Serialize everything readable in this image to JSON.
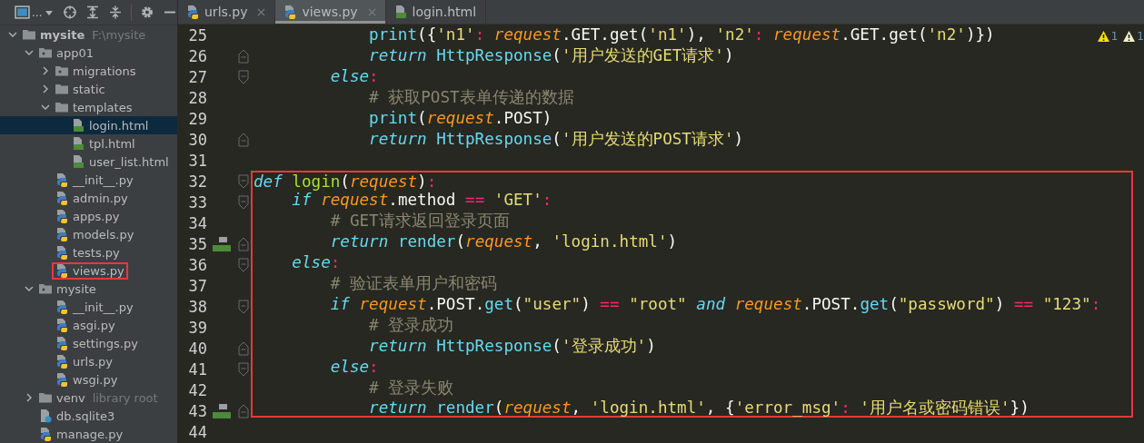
{
  "toolbar": {
    "view_selector": {
      "label": "..."
    },
    "buttons": [
      {
        "kind": "locate"
      },
      {
        "kind": "expand"
      },
      {
        "kind": "collapse"
      },
      {
        "kind": "settings"
      },
      {
        "kind": "hide"
      }
    ]
  },
  "project_tree": [
    {
      "label": "mysite",
      "hint": "F:\\mysite",
      "kind": "folder",
      "bold": true,
      "expanded": true,
      "selected": false,
      "boxed": false,
      "children": [
        {
          "label": "app01",
          "kind": "package",
          "expanded": true,
          "selected": false,
          "boxed": false,
          "children": [
            {
              "label": "migrations",
              "kind": "package",
              "expanded": false,
              "selected": false,
              "boxed": false
            },
            {
              "label": "static",
              "kind": "folder",
              "expanded": false,
              "selected": false,
              "boxed": false
            },
            {
              "label": "templates",
              "kind": "folder",
              "expanded": true,
              "selected": false,
              "boxed": false,
              "children": [
                {
                  "label": "login.html",
                  "kind": "html",
                  "selected": true,
                  "boxed": false
                },
                {
                  "label": "tpl.html",
                  "kind": "html",
                  "selected": false,
                  "boxed": false
                },
                {
                  "label": "user_list.html",
                  "kind": "html",
                  "selected": false,
                  "boxed": false
                }
              ]
            },
            {
              "label": "__init__.py",
              "kind": "python",
              "selected": false,
              "boxed": false
            },
            {
              "label": "admin.py",
              "kind": "python",
              "selected": false,
              "boxed": false
            },
            {
              "label": "apps.py",
              "kind": "python",
              "selected": false,
              "boxed": false
            },
            {
              "label": "models.py",
              "kind": "python",
              "selected": false,
              "boxed": false
            },
            {
              "label": "tests.py",
              "kind": "python",
              "selected": false,
              "boxed": false
            },
            {
              "label": "views.py",
              "kind": "python",
              "selected": false,
              "boxed": true
            }
          ]
        },
        {
          "label": "mysite",
          "kind": "package",
          "expanded": true,
          "selected": false,
          "boxed": false,
          "children": [
            {
              "label": "__init__.py",
              "kind": "python",
              "selected": false,
              "boxed": false
            },
            {
              "label": "asgi.py",
              "kind": "python",
              "selected": false,
              "boxed": false
            },
            {
              "label": "settings.py",
              "kind": "python",
              "selected": false,
              "boxed": false
            },
            {
              "label": "urls.py",
              "kind": "python",
              "selected": false,
              "boxed": false
            },
            {
              "label": "wsgi.py",
              "kind": "python",
              "selected": false,
              "boxed": false
            }
          ]
        },
        {
          "label": "venv",
          "hint": "library root",
          "kind": "folder",
          "expanded": false,
          "selected": false,
          "boxed": false
        },
        {
          "label": "db.sqlite3",
          "kind": "unknown",
          "selected": false,
          "boxed": false
        },
        {
          "label": "manage.py",
          "kind": "python",
          "selected": false,
          "boxed": false
        }
      ]
    }
  ],
  "tabs": [
    {
      "label": "urls.py",
      "kind": "python",
      "selected": false,
      "closable": true
    },
    {
      "label": "views.py",
      "kind": "python",
      "selected": true,
      "closable": true
    },
    {
      "label": "login.html",
      "kind": "html",
      "selected": false,
      "closable": false
    }
  ],
  "warnings": [
    {
      "kind": "warning",
      "count": "1"
    },
    {
      "kind": "weak",
      "count": "1"
    }
  ],
  "editor": {
    "lines": [
      {
        "children": [
          {
            "children": [
              {
                "children": [
                  {
                    "number": "25",
                    "boxed": false,
                    "fold_start": false,
                    "fold_end": false,
                    "html_marker": false,
                    "tokens": [
                      {
                        "kind": "bi",
                        "text": "print"
                      },
                      {
                        "kind": "pl",
                        "text": "({"
                      },
                      {
                        "kind": "str",
                        "text": "'n1'"
                      },
                      {
                        "kind": "op",
                        "text": ":"
                      },
                      {
                        "kind": "param",
                        "text": " request"
                      },
                      {
                        "kind": "pl",
                        "text": ".GET.get("
                      },
                      {
                        "kind": "str",
                        "text": "'n1'"
                      },
                      {
                        "kind": "pl",
                        "text": "), "
                      },
                      {
                        "kind": "str",
                        "text": "'n2'"
                      },
                      {
                        "kind": "op",
                        "text": ":"
                      },
                      {
                        "kind": "param",
                        "text": " request"
                      },
                      {
                        "kind": "pl",
                        "text": ".GET.get("
                      },
                      {
                        "kind": "str",
                        "text": "'n2'"
                      },
                      {
                        "kind": "pl",
                        "text": ")})"
                      }
                    ]
                  },
                  {
                    "number": "26",
                    "boxed": false,
                    "fold_start": false,
                    "fold_end": true,
                    "html_marker": false,
                    "tokens": [
                      {
                        "kind": "kw",
                        "text": "return"
                      },
                      {
                        "kind": "bi",
                        "text": " HttpResponse"
                      },
                      {
                        "kind": "pl",
                        "text": "("
                      },
                      {
                        "kind": "str",
                        "text": "'用户发送的GET请求'"
                      },
                      {
                        "kind": "pl",
                        "text": ")"
                      }
                    ]
                  }
                ]
              },
              {
                "number": "27",
                "boxed": false,
                "fold_start": true,
                "fold_end": false,
                "html_marker": false,
                "tokens": [
                  {
                    "kind": "kw",
                    "text": "else"
                  },
                  {
                    "kind": "op",
                    "text": ":"
                  }
                ],
                "children": [
                  {
                    "number": "28",
                    "boxed": false,
                    "fold_start": false,
                    "fold_end": false,
                    "html_marker": false,
                    "tokens": [
                      {
                        "kind": "cmt",
                        "text": "# 获取POST表单传递的数据"
                      }
                    ]
                  },
                  {
                    "number": "29",
                    "boxed": false,
                    "fold_start": false,
                    "fold_end": false,
                    "html_marker": false,
                    "tokens": [
                      {
                        "kind": "bi",
                        "text": "print"
                      },
                      {
                        "kind": "pl",
                        "text": "("
                      },
                      {
                        "kind": "param",
                        "text": "request"
                      },
                      {
                        "kind": "pl",
                        "text": ".POST)"
                      }
                    ]
                  },
                  {
                    "number": "30",
                    "boxed": false,
                    "fold_start": false,
                    "fold_end": true,
                    "html_marker": false,
                    "tokens": [
                      {
                        "kind": "kw",
                        "text": "return"
                      },
                      {
                        "kind": "bi",
                        "text": " HttpResponse"
                      },
                      {
                        "kind": "pl",
                        "text": "("
                      },
                      {
                        "kind": "str",
                        "text": "'用户发送的POST请求'"
                      },
                      {
                        "kind": "pl",
                        "text": ")"
                      }
                    ]
                  }
                ]
              }
            ]
          }
        ]
      },
      {
        "number": "31",
        "fold_start": false,
        "fold_end": false,
        "html_marker": false
      },
      {
        "number": "32",
        "boxed": true,
        "fold_start": true,
        "fold_end": false,
        "html_marker": false,
        "tokens": [
          {
            "kind": "kw",
            "text": "def"
          },
          {
            "kind": "fn",
            "text": " login"
          },
          {
            "kind": "pl",
            "text": "("
          },
          {
            "kind": "param",
            "text": "request"
          },
          {
            "kind": "pl",
            "text": ")"
          },
          {
            "kind": "op",
            "text": ":"
          }
        ],
        "children": [
          {
            "number": "33",
            "boxed": true,
            "fold_start": true,
            "fold_end": false,
            "html_marker": false,
            "tokens": [
              {
                "kind": "kw",
                "text": "if"
              },
              {
                "kind": "param",
                "text": " request"
              },
              {
                "kind": "pl",
                "text": ".method "
              },
              {
                "kind": "op",
                "text": "=="
              },
              {
                "kind": "str",
                "text": " 'GET'"
              },
              {
                "kind": "op",
                "text": ":"
              }
            ],
            "children": [
              {
                "number": "34",
                "boxed": true,
                "fold_start": false,
                "fold_end": false,
                "html_marker": false,
                "tokens": [
                  {
                    "kind": "cmt",
                    "text": "# GET请求返回登录页面"
                  }
                ]
              },
              {
                "number": "35",
                "boxed": true,
                "fold_start": false,
                "fold_end": true,
                "html_marker": true,
                "tokens": [
                  {
                    "kind": "kw",
                    "text": "return"
                  },
                  {
                    "kind": "bi",
                    "text": " render"
                  },
                  {
                    "kind": "pl",
                    "text": "("
                  },
                  {
                    "kind": "param",
                    "text": "request"
                  },
                  {
                    "kind": "pl",
                    "text": ", "
                  },
                  {
                    "kind": "str",
                    "text": "'login.html'"
                  },
                  {
                    "kind": "pl",
                    "text": ")"
                  }
                ]
              }
            ]
          },
          {
            "number": "36",
            "boxed": true,
            "fold_start": true,
            "fold_end": false,
            "html_marker": false,
            "tokens": [
              {
                "kind": "kw",
                "text": "else"
              },
              {
                "kind": "op",
                "text": ":"
              }
            ],
            "children": [
              {
                "number": "37",
                "boxed": true,
                "fold_start": false,
                "fold_end": false,
                "html_marker": false,
                "tokens": [
                  {
                    "kind": "cmt",
                    "text": "# 验证表单用户和密码"
                  }
                ]
              },
              {
                "number": "38",
                "boxed": true,
                "fold_start": true,
                "fold_end": false,
                "html_marker": false,
                "tokens": [
                  {
                    "kind": "kw",
                    "text": "if"
                  },
                  {
                    "kind": "param",
                    "text": " request"
                  },
                  {
                    "kind": "pl",
                    "text": ".POST."
                  },
                  {
                    "kind": "bi",
                    "text": "get"
                  },
                  {
                    "kind": "pl",
                    "text": "("
                  },
                  {
                    "kind": "str",
                    "text": "\"user\""
                  },
                  {
                    "kind": "pl",
                    "text": ") "
                  },
                  {
                    "kind": "op",
                    "text": "=="
                  },
                  {
                    "kind": "str",
                    "text": " \"root\""
                  },
                  {
                    "kind": "kw",
                    "text": " and"
                  },
                  {
                    "kind": "param",
                    "text": " request"
                  },
                  {
                    "kind": "pl",
                    "text": ".POST."
                  },
                  {
                    "kind": "bi",
                    "text": "get"
                  },
                  {
                    "kind": "pl",
                    "text": "("
                  },
                  {
                    "kind": "str",
                    "text": "\"password\""
                  },
                  {
                    "kind": "pl",
                    "text": ") "
                  },
                  {
                    "kind": "op",
                    "text": "=="
                  },
                  {
                    "kind": "str",
                    "text": " \"123\""
                  },
                  {
                    "kind": "op",
                    "text": ":"
                  }
                ],
                "children": [
                  {
                    "number": "39",
                    "boxed": true,
                    "fold_start": false,
                    "fold_end": false,
                    "html_marker": false,
                    "tokens": [
                      {
                        "kind": "cmt",
                        "text": "# 登录成功"
                      }
                    ]
                  },
                  {
                    "number": "40",
                    "boxed": true,
                    "fold_start": false,
                    "fold_end": true,
                    "html_marker": false,
                    "tokens": [
                      {
                        "kind": "kw",
                        "text": "return"
                      },
                      {
                        "kind": "bi",
                        "text": " HttpResponse"
                      },
                      {
                        "kind": "pl",
                        "text": "("
                      },
                      {
                        "kind": "str",
                        "text": "'登录成功'"
                      },
                      {
                        "kind": "pl",
                        "text": ")"
                      }
                    ]
                  }
                ]
              },
              {
                "number": "41",
                "boxed": true,
                "fold_start": true,
                "fold_end": false,
                "html_marker": false,
                "tokens": [
                  {
                    "kind": "kw",
                    "text": "else"
                  },
                  {
                    "kind": "op",
                    "text": ":"
                  }
                ],
                "children": [
                  {
                    "number": "42",
                    "boxed": true,
                    "fold_start": false,
                    "fold_end": false,
                    "html_marker": false,
                    "tokens": [
                      {
                        "kind": "cmt",
                        "text": "# 登录失败"
                      }
                    ]
                  },
                  {
                    "number": "43",
                    "boxed": true,
                    "fold_start": false,
                    "fold_end": true,
                    "html_marker": true,
                    "tokens": [
                      {
                        "kind": "kw",
                        "text": "return"
                      },
                      {
                        "kind": "bi",
                        "text": " render"
                      },
                      {
                        "kind": "pl",
                        "text": "("
                      },
                      {
                        "kind": "param",
                        "text": "request"
                      },
                      {
                        "kind": "pl",
                        "text": ", "
                      },
                      {
                        "kind": "str",
                        "text": "'login.html'"
                      },
                      {
                        "kind": "pl",
                        "text": ", {"
                      },
                      {
                        "kind": "str",
                        "text": "'error_msg'"
                      },
                      {
                        "kind": "op",
                        "text": ":"
                      },
                      {
                        "kind": "str",
                        "text": " '用户名或密码错误'"
                      },
                      {
                        "kind": "pl",
                        "text": "})"
                      }
                    ]
                  }
                ]
              }
            ]
          }
        ]
      },
      {
        "number": "44",
        "fold_start": false,
        "fold_end": false,
        "html_marker": false
      }
    ]
  }
}
